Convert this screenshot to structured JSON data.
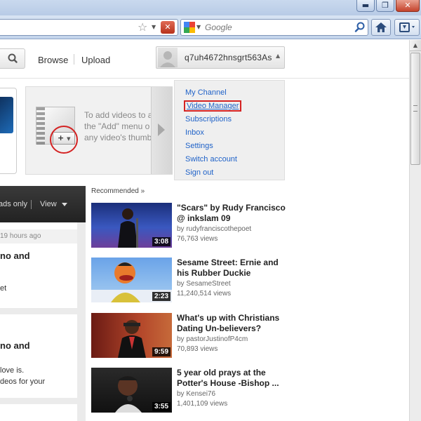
{
  "browser": {
    "window_controls": {
      "minimize": "▬",
      "maximize": "❐",
      "close": "✕"
    },
    "url_stop": "✕",
    "search_placeholder": "Google",
    "colors": {
      "accent": "#1f62c8",
      "highlight": "#d42222"
    }
  },
  "masthead": {
    "browse": "Browse",
    "upload": "Upload",
    "username": "q7uh4672hnsgrt563As"
  },
  "add_panel": {
    "line1": "To add videos to a",
    "line2": "the \"Add\" menu o",
    "line3": "any video's thumb",
    "add_button": "+"
  },
  "account_menu": {
    "items": [
      "My Channel",
      "Video Manager",
      "Subscriptions",
      "Inbox",
      "Settings",
      "Switch account",
      "Sign out"
    ],
    "highlighted": "Video Manager"
  },
  "feed": {
    "filter": "ads only",
    "view": "View",
    "time": "19 hours ago",
    "card1_title": "no and",
    "card1_line": "et",
    "card2_title": "no and",
    "card2_line1": "love is.",
    "card2_line2": "deos for your"
  },
  "recommended": {
    "label": "Recommended »",
    "videos": [
      {
        "title": "\"Scars\" by Rudy Francisco @ inkslam 09",
        "by": "by rudyfranciscothepoet",
        "views": "76,763 views",
        "duration": "3:08"
      },
      {
        "title": "Sesame Street: Ernie and his Rubber Duckie",
        "by": "by SesameStreet",
        "views": "11,240,514 views",
        "duration": "2:23"
      },
      {
        "title": "What's up with Christians Dating Un-believers?",
        "by": "by pastorJustinofP4cm",
        "views": "70,893 views",
        "duration": "9:59"
      },
      {
        "title": "5 year old prays at the Potter's House -Bishop ...",
        "by": "by Kensei76",
        "views": "1,401,109 views",
        "duration": "3:55"
      }
    ]
  }
}
